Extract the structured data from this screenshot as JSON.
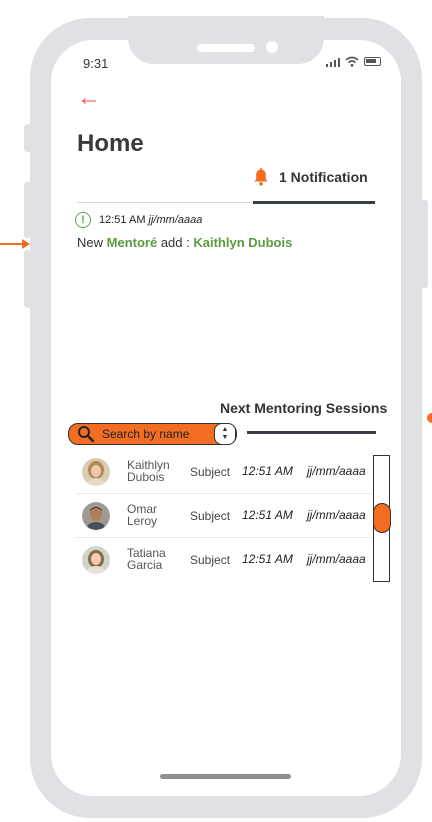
{
  "status": {
    "time": "9:31"
  },
  "header": {
    "title": "Home"
  },
  "notifications": {
    "tab_label": "1 Notification",
    "items": [
      {
        "time": "12:51 AM",
        "date": "jj/mm/aaaa",
        "prefix": "New",
        "role": "Mentoré",
        "action": "add :",
        "person": "Kaithlyn Dubois"
      }
    ]
  },
  "sessions": {
    "title": "Next Mentoring Sessions",
    "search_placeholder": "Search by name",
    "rows": [
      {
        "first": "Kaithlyn",
        "last": "Dubois",
        "subject": "Subject",
        "time": "12:51 AM",
        "date": "jj/mm/aaaa"
      },
      {
        "first": "Omar",
        "last": "Leroy",
        "subject": "Subject",
        "time": "12:51 AM",
        "date": "jj/mm/aaaa"
      },
      {
        "first": "Tatiana",
        "last": "Garcia",
        "subject": "Subject",
        "time": "12:51 AM",
        "date": "jj/mm/aaaa"
      }
    ]
  },
  "colors": {
    "accent": "#f26d21",
    "success": "#5a9a40",
    "back": "#ef4f5a",
    "frame": "#dfe1e5"
  }
}
